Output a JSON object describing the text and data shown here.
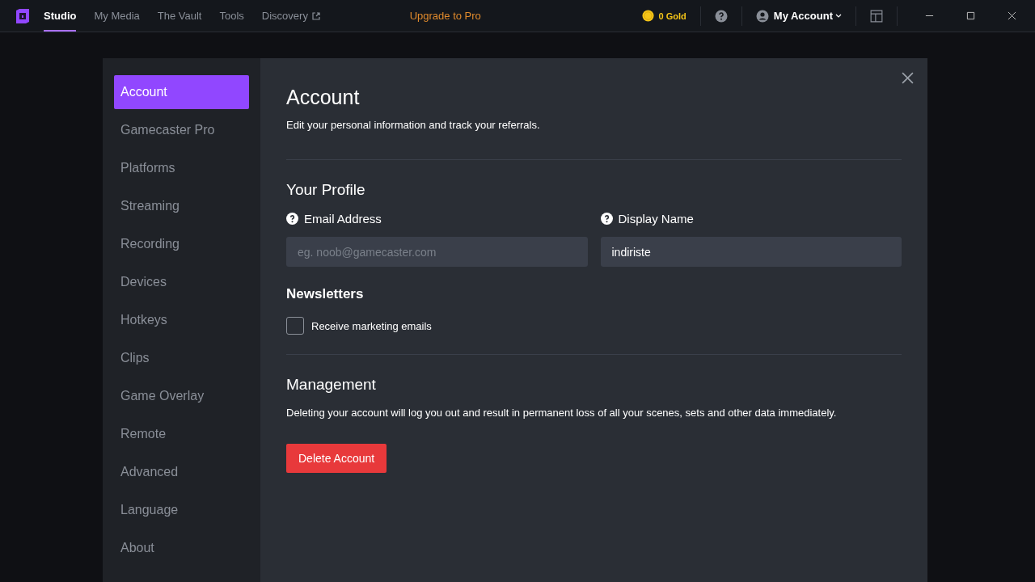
{
  "nav": {
    "tabs": [
      {
        "label": "Studio",
        "selected": true
      },
      {
        "label": "My Media",
        "selected": false
      },
      {
        "label": "The Vault",
        "selected": false
      },
      {
        "label": "Tools",
        "selected": false
      },
      {
        "label": "Discovery",
        "selected": false,
        "external": true
      }
    ],
    "upgrade": "Upgrade to Pro",
    "gold": "0 Gold",
    "account": "My Account"
  },
  "sidebar": {
    "items": [
      {
        "label": "Account",
        "selected": true
      },
      {
        "label": "Gamecaster Pro",
        "selected": false
      },
      {
        "label": "Platforms",
        "selected": false
      },
      {
        "label": "Streaming",
        "selected": false
      },
      {
        "label": "Recording",
        "selected": false
      },
      {
        "label": "Devices",
        "selected": false
      },
      {
        "label": "Hotkeys",
        "selected": false
      },
      {
        "label": "Clips",
        "selected": false
      },
      {
        "label": "Game Overlay",
        "selected": false
      },
      {
        "label": "Remote",
        "selected": false
      },
      {
        "label": "Advanced",
        "selected": false
      },
      {
        "label": "Language",
        "selected": false
      },
      {
        "label": "About",
        "selected": false
      }
    ]
  },
  "content": {
    "title": "Account",
    "subtitle": "Edit your personal information and track your referrals.",
    "profile": {
      "heading": "Your Profile",
      "fields": [
        {
          "label": "Email Address",
          "placeholder": "eg. noob@gamecaster.com"
        },
        {
          "label": "Display Name",
          "value": "indiriste"
        }
      ]
    },
    "newsletters": {
      "heading": "Newsletters",
      "checkbox": {
        "label": "Receive marketing emails",
        "checked": false
      }
    },
    "management": {
      "heading": "Management",
      "text": "Deleting your account will log you out and result in permanent loss of all your scenes, sets and other data immediately.",
      "button": "Delete Account"
    }
  }
}
